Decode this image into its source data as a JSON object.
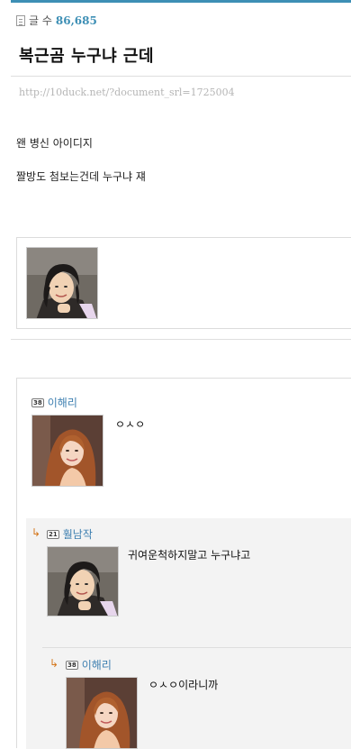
{
  "post": {
    "count_label": "글 수",
    "count_value": "86,685",
    "title": "복근곰 누구냐 근데",
    "url": "http://10duck.net/?document_srl=1725004",
    "body": [
      "왠 병신 아이디지",
      "짤방도 첨보는건데 누구냐 쟤"
    ]
  },
  "comments": [
    {
      "level": "38",
      "author": "이해리",
      "text": "ㅇㅅㅇ",
      "is_reply": false
    },
    {
      "level": "21",
      "author": "훨남작",
      "text": "귀여운척하지말고 누구냐고",
      "is_reply": true
    },
    {
      "level": "38",
      "author": "이해리",
      "text": "ㅇㅅㅇ이라니까",
      "is_reply": true
    }
  ],
  "icons": {
    "doc": "document-icon",
    "reply": "↳"
  },
  "colors": {
    "accent": "#3d8fb5",
    "reply_arrow": "#d4781e",
    "reply_bg": "#f3f3f3"
  }
}
